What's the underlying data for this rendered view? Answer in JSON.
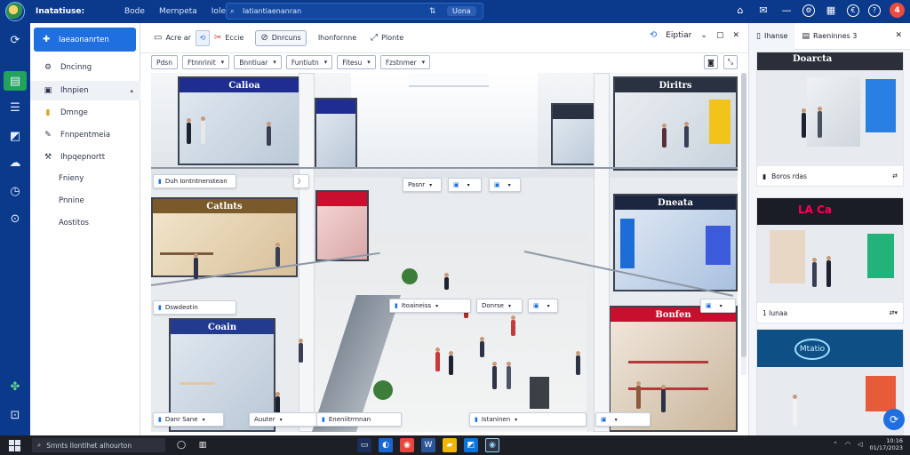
{
  "app": {
    "title": "Inatatiuse:",
    "menu": [
      "Bode",
      "Mernpeta",
      "Iole"
    ],
    "search_text": "Iatiantiaenanran",
    "search_pill": "Uona"
  },
  "user": {
    "initial": "4"
  },
  "sidebar": {
    "primary_button": "Iaeaonanrten",
    "items": [
      {
        "label": "Dncinng",
        "icon": "⚙"
      },
      {
        "label": "Ihnpien",
        "icon": "▣",
        "expanded_caret": "▴"
      },
      {
        "label": "Dmnge",
        "icon": "▮"
      },
      {
        "label": "Fnnpentmeia",
        "icon": "✎"
      },
      {
        "label": "Ihpqepnortt",
        "icon": "⚒"
      }
    ],
    "subitems": [
      "Fnieny",
      "Pnnine",
      "Aostitos"
    ]
  },
  "toolbar": {
    "items": [
      {
        "label": "Acre",
        "extra": "ar",
        "icon": "▭"
      },
      {
        "label": "",
        "icon": "⟲"
      },
      {
        "label": "Eccie",
        "icon": "✂"
      },
      {
        "label": "Dnrcuns",
        "icon": "⊘"
      },
      {
        "label": "Ihonfornne",
        "icon": ""
      },
      {
        "label": "Plonte",
        "icon": "⤢"
      }
    ],
    "right_label": "Eiptiar"
  },
  "filters": [
    "Pdsn",
    "Ftnnrinit",
    "Bnntiuar",
    "Funtiutn",
    "Fitesu",
    "Fzstnmer"
  ],
  "camera_labels": [
    {
      "text": "Duh Iontntnenstean",
      "chev": "〉"
    },
    {
      "text": "Pasnr",
      "chev": "▾"
    },
    {
      "text": "",
      "chev": "▾"
    },
    {
      "text": "",
      "chev": "▾"
    },
    {
      "text": "Dswdeotin",
      "chev": ""
    },
    {
      "text": "Itoaineiss",
      "chev": "▾"
    },
    {
      "text": "Donrse",
      "chev": "▾"
    },
    {
      "text": "",
      "chev": "▾"
    },
    {
      "text": "",
      "chev": "▾"
    },
    {
      "text": "Danr Sane",
      "chev": "▾"
    },
    {
      "text": "Auuter",
      "chev": "▾"
    },
    {
      "text": "Eneniitrrnnan",
      "chev": ""
    },
    {
      "text": "Istaninen",
      "chev": "▾"
    },
    {
      "text": "",
      "chev": "▾"
    }
  ],
  "store_signs": [
    "Calioa",
    "Coain",
    "Catlnts",
    "Dneata",
    "Diritrs",
    "Bonfen"
  ],
  "right_panel": {
    "tabs": [
      "Ihanse",
      "Raeninnes"
    ],
    "tab_extra": "3",
    "cards": [
      {
        "caption": "Boros rdas",
        "action": "⇄",
        "sign": "Doarcta"
      },
      {
        "caption": "1 Iunaa",
        "action": "⇄▾",
        "sign": "LA Ca"
      },
      {
        "caption": "",
        "action": "",
        "sign": "Mtatio"
      }
    ]
  },
  "taskbar": {
    "search_text": "Srnnts Ilontlhet alhourton",
    "time": "10:16",
    "date": "01/17/2023"
  },
  "colors": {
    "brand": "#0b3a8c",
    "accent": "#1f6fe0",
    "active_rail": "#22a35a"
  }
}
